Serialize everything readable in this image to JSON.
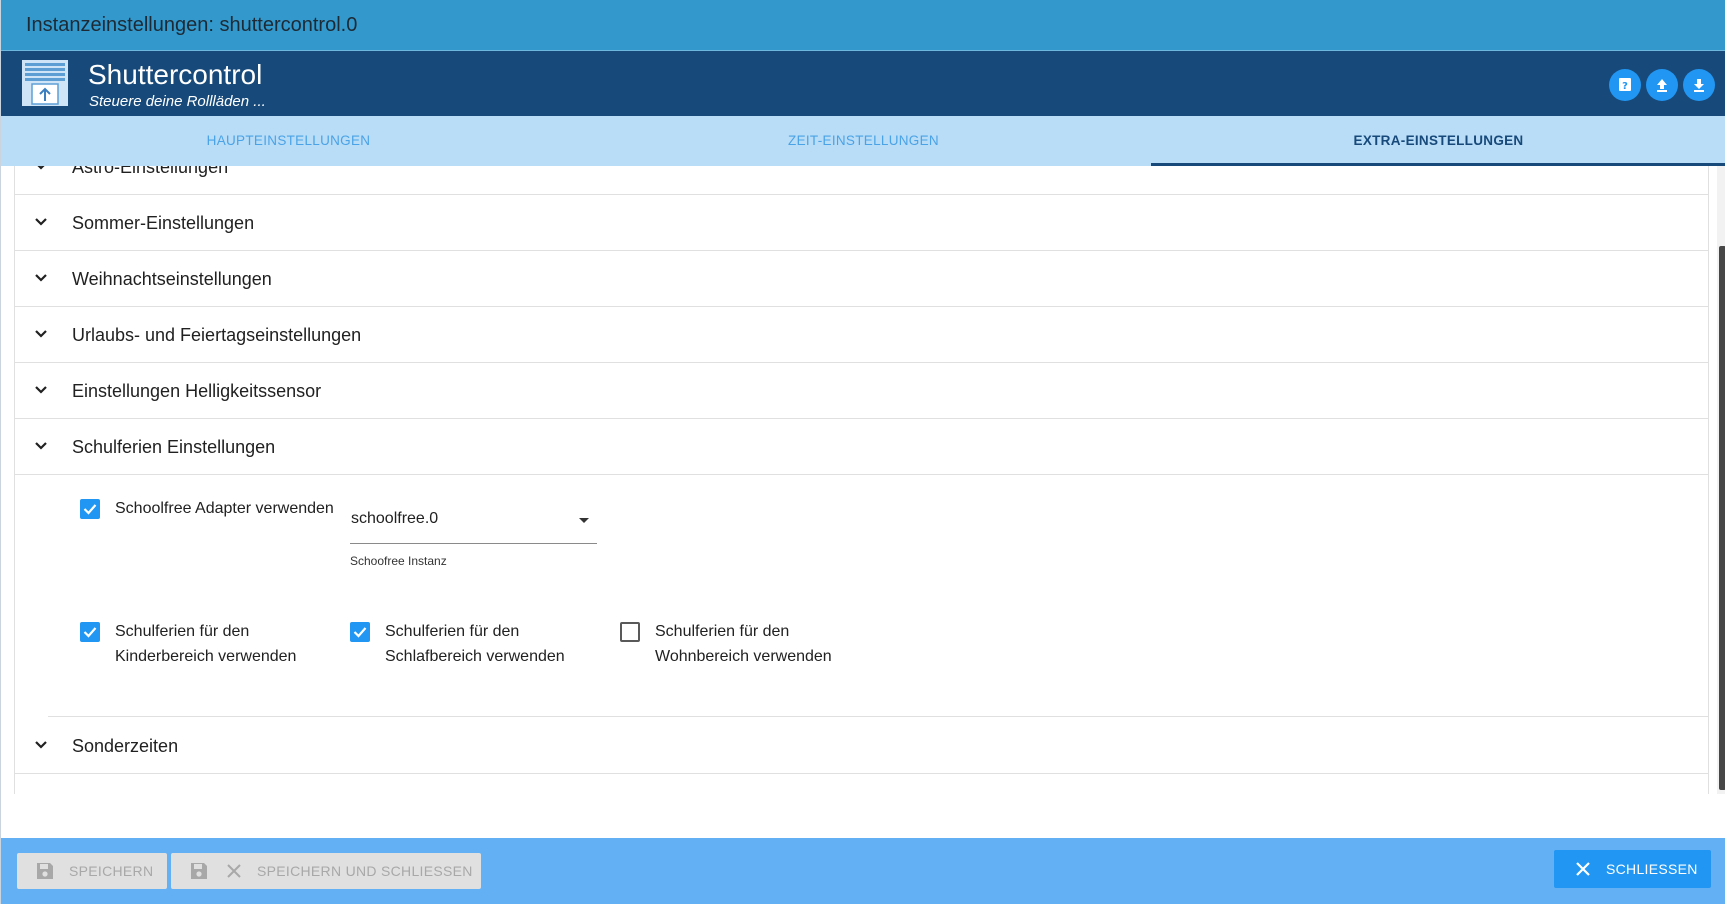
{
  "window": {
    "title": "Instanzeinstellungen: shuttercontrol.0"
  },
  "app": {
    "name": "Shuttercontrol",
    "subtitle": "Steuere deine Rollläden ..."
  },
  "header_buttons": [
    "help-icon",
    "upload-icon",
    "download-icon"
  ],
  "tabs": [
    {
      "label": "HAUPTEINSTELLUNGEN",
      "active": false
    },
    {
      "label": "ZEIT-EINSTELLUNGEN",
      "active": false
    },
    {
      "label": "EXTRA-EINSTELLUNGEN",
      "active": true
    }
  ],
  "accordion": [
    {
      "label": "Astro-Einstellungen"
    },
    {
      "label": "Sommer-Einstellungen"
    },
    {
      "label": "Weihnachtseinstellungen"
    },
    {
      "label": "Urlaubs- und Feiertagseinstellungen"
    },
    {
      "label": "Einstellungen Helligkeitssensor"
    },
    {
      "label": "Schulferien Einstellungen"
    },
    {
      "label": "Sonderzeiten"
    }
  ],
  "schulferien": {
    "schoolfree_checkbox": {
      "label": "Schoolfree Adapter verwenden",
      "checked": true
    },
    "instance_select": {
      "value": "schoolfree.0",
      "helper": "Schoofree Instanz"
    },
    "kinder": {
      "label": "Schulferien für den Kinderbereich verwenden",
      "checked": true
    },
    "schlaf": {
      "label": "Schulferien für den Schlafbereich verwenden",
      "checked": true
    },
    "wohn": {
      "label": "Schulferien für den Wohnbereich verwenden",
      "checked": false
    }
  },
  "footer": {
    "save_label": "SPEICHERN",
    "save_close_label": "SPEICHERN UND SCHLIESSEN",
    "close_label": "SCHLIESSEN"
  },
  "colors": {
    "titlebar": "#3399cc",
    "header": "#174a7a",
    "tabs_bg": "#b9dcf7",
    "accent": "#2196f3",
    "footer": "#64b0f4"
  }
}
